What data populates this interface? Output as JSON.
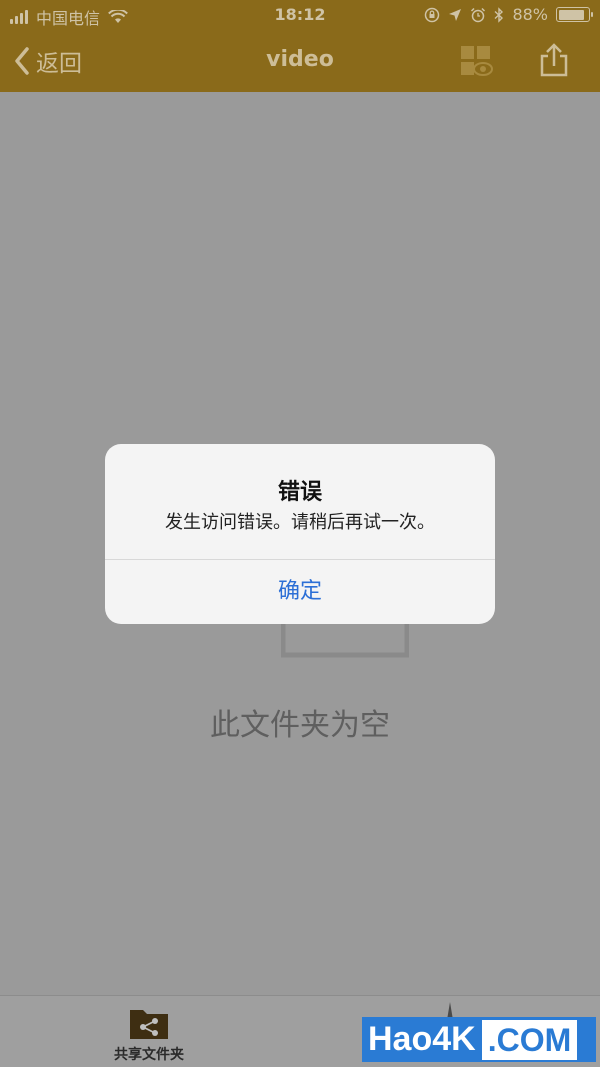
{
  "status_bar": {
    "carrier": "中国电信",
    "time": "18:12",
    "battery_percent": "88%",
    "battery_level": 0.88
  },
  "nav": {
    "back_label": "返回",
    "title": "video"
  },
  "content": {
    "empty_message": "此文件夹为空"
  },
  "alert": {
    "title": "错误",
    "message": "发生访问错误。请稍后再试一次。",
    "confirm_label": "确定"
  },
  "tabbar": {
    "shared_label": "共享文件夹"
  },
  "watermark": {
    "main": "Hao4K",
    "suffix": ".COM"
  },
  "icons": {
    "back": "chevron-left-icon",
    "view": "grid-eye-icon",
    "share": "share-icon",
    "shared_folder": "shared-folder-icon"
  },
  "colors": {
    "header": "#8a6a1a",
    "accent_link": "#2c6fd6",
    "watermark": "#2a7bd4"
  }
}
